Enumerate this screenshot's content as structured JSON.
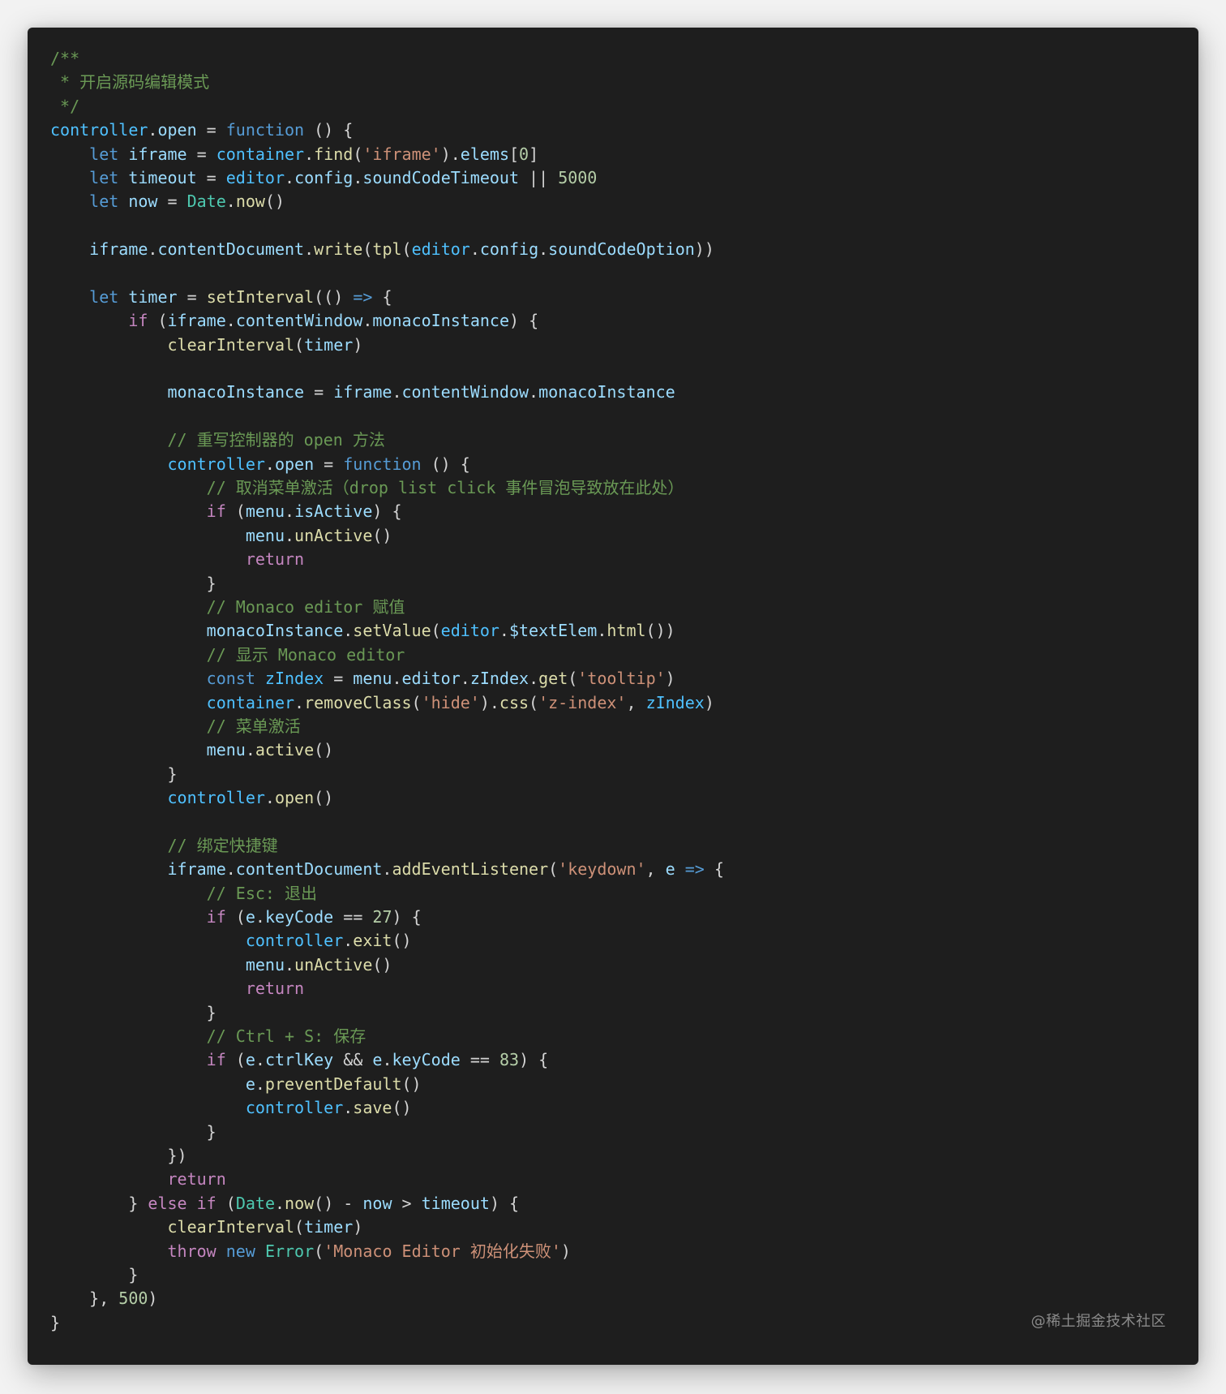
{
  "code": {
    "language": "javascript",
    "lines": [
      [
        {
          "t": "/**",
          "c": "comment"
        }
      ],
      [
        {
          "t": " * 开启源码编辑模式",
          "c": "comment"
        }
      ],
      [
        {
          "t": " */",
          "c": "comment"
        }
      ],
      [
        {
          "t": "controller",
          "c": "obj"
        },
        {
          "t": ".",
          "c": "plain"
        },
        {
          "t": "open",
          "c": "var"
        },
        {
          "t": " = ",
          "c": "plain"
        },
        {
          "t": "function",
          "c": "key"
        },
        {
          "t": " () {",
          "c": "plain"
        }
      ],
      [
        {
          "t": "    ",
          "c": "plain"
        },
        {
          "t": "let",
          "c": "key"
        },
        {
          "t": " ",
          "c": "plain"
        },
        {
          "t": "iframe",
          "c": "var"
        },
        {
          "t": " = ",
          "c": "plain"
        },
        {
          "t": "container",
          "c": "obj"
        },
        {
          "t": ".",
          "c": "plain"
        },
        {
          "t": "find",
          "c": "fn"
        },
        {
          "t": "(",
          "c": "plain"
        },
        {
          "t": "'iframe'",
          "c": "str"
        },
        {
          "t": ").",
          "c": "plain"
        },
        {
          "t": "elems",
          "c": "var"
        },
        {
          "t": "[",
          "c": "plain"
        },
        {
          "t": "0",
          "c": "num"
        },
        {
          "t": "]",
          "c": "plain"
        }
      ],
      [
        {
          "t": "    ",
          "c": "plain"
        },
        {
          "t": "let",
          "c": "key"
        },
        {
          "t": " ",
          "c": "plain"
        },
        {
          "t": "timeout",
          "c": "var"
        },
        {
          "t": " = ",
          "c": "plain"
        },
        {
          "t": "editor",
          "c": "obj"
        },
        {
          "t": ".",
          "c": "plain"
        },
        {
          "t": "config",
          "c": "var"
        },
        {
          "t": ".",
          "c": "plain"
        },
        {
          "t": "soundCodeTimeout",
          "c": "var"
        },
        {
          "t": " || ",
          "c": "plain"
        },
        {
          "t": "5000",
          "c": "num"
        }
      ],
      [
        {
          "t": "    ",
          "c": "plain"
        },
        {
          "t": "let",
          "c": "key"
        },
        {
          "t": " ",
          "c": "plain"
        },
        {
          "t": "now",
          "c": "var"
        },
        {
          "t": " = ",
          "c": "plain"
        },
        {
          "t": "Date",
          "c": "type"
        },
        {
          "t": ".",
          "c": "plain"
        },
        {
          "t": "now",
          "c": "fn"
        },
        {
          "t": "()",
          "c": "plain"
        }
      ],
      [],
      [
        {
          "t": "    ",
          "c": "plain"
        },
        {
          "t": "iframe",
          "c": "var"
        },
        {
          "t": ".",
          "c": "plain"
        },
        {
          "t": "contentDocument",
          "c": "var"
        },
        {
          "t": ".",
          "c": "plain"
        },
        {
          "t": "write",
          "c": "fn"
        },
        {
          "t": "(",
          "c": "plain"
        },
        {
          "t": "tpl",
          "c": "fn"
        },
        {
          "t": "(",
          "c": "plain"
        },
        {
          "t": "editor",
          "c": "obj"
        },
        {
          "t": ".",
          "c": "plain"
        },
        {
          "t": "config",
          "c": "var"
        },
        {
          "t": ".",
          "c": "plain"
        },
        {
          "t": "soundCodeOption",
          "c": "var"
        },
        {
          "t": "))",
          "c": "plain"
        }
      ],
      [],
      [
        {
          "t": "    ",
          "c": "plain"
        },
        {
          "t": "let",
          "c": "key"
        },
        {
          "t": " ",
          "c": "plain"
        },
        {
          "t": "timer",
          "c": "var"
        },
        {
          "t": " = ",
          "c": "plain"
        },
        {
          "t": "setInterval",
          "c": "fn"
        },
        {
          "t": "(() ",
          "c": "plain"
        },
        {
          "t": "=>",
          "c": "key"
        },
        {
          "t": " {",
          "c": "plain"
        }
      ],
      [
        {
          "t": "        ",
          "c": "plain"
        },
        {
          "t": "if",
          "c": "ctrl"
        },
        {
          "t": " (",
          "c": "plain"
        },
        {
          "t": "iframe",
          "c": "var"
        },
        {
          "t": ".",
          "c": "plain"
        },
        {
          "t": "contentWindow",
          "c": "var"
        },
        {
          "t": ".",
          "c": "plain"
        },
        {
          "t": "monacoInstance",
          "c": "var"
        },
        {
          "t": ") {",
          "c": "plain"
        }
      ],
      [
        {
          "t": "            ",
          "c": "plain"
        },
        {
          "t": "clearInterval",
          "c": "fn"
        },
        {
          "t": "(",
          "c": "plain"
        },
        {
          "t": "timer",
          "c": "var"
        },
        {
          "t": ")",
          "c": "plain"
        }
      ],
      [],
      [
        {
          "t": "            ",
          "c": "plain"
        },
        {
          "t": "monacoInstance",
          "c": "var"
        },
        {
          "t": " = ",
          "c": "plain"
        },
        {
          "t": "iframe",
          "c": "var"
        },
        {
          "t": ".",
          "c": "plain"
        },
        {
          "t": "contentWindow",
          "c": "var"
        },
        {
          "t": ".",
          "c": "plain"
        },
        {
          "t": "monacoInstance",
          "c": "var"
        }
      ],
      [],
      [
        {
          "t": "            ",
          "c": "plain"
        },
        {
          "t": "// 重写控制器的 open 方法",
          "c": "comment"
        }
      ],
      [
        {
          "t": "            ",
          "c": "plain"
        },
        {
          "t": "controller",
          "c": "obj"
        },
        {
          "t": ".",
          "c": "plain"
        },
        {
          "t": "open",
          "c": "var"
        },
        {
          "t": " = ",
          "c": "plain"
        },
        {
          "t": "function",
          "c": "key"
        },
        {
          "t": " () {",
          "c": "plain"
        }
      ],
      [
        {
          "t": "                ",
          "c": "plain"
        },
        {
          "t": "// 取消菜单激活（drop list click 事件冒泡导致放在此处）",
          "c": "comment"
        }
      ],
      [
        {
          "t": "                ",
          "c": "plain"
        },
        {
          "t": "if",
          "c": "ctrl"
        },
        {
          "t": " (",
          "c": "plain"
        },
        {
          "t": "menu",
          "c": "var"
        },
        {
          "t": ".",
          "c": "plain"
        },
        {
          "t": "isActive",
          "c": "var"
        },
        {
          "t": ") {",
          "c": "plain"
        }
      ],
      [
        {
          "t": "                    ",
          "c": "plain"
        },
        {
          "t": "menu",
          "c": "var"
        },
        {
          "t": ".",
          "c": "plain"
        },
        {
          "t": "unActive",
          "c": "fn"
        },
        {
          "t": "()",
          "c": "plain"
        }
      ],
      [
        {
          "t": "                    ",
          "c": "plain"
        },
        {
          "t": "return",
          "c": "ctrl"
        }
      ],
      [
        {
          "t": "                }",
          "c": "plain"
        }
      ],
      [
        {
          "t": "                ",
          "c": "plain"
        },
        {
          "t": "// Monaco editor 赋值",
          "c": "comment"
        }
      ],
      [
        {
          "t": "                ",
          "c": "plain"
        },
        {
          "t": "monacoInstance",
          "c": "var"
        },
        {
          "t": ".",
          "c": "plain"
        },
        {
          "t": "setValue",
          "c": "fn"
        },
        {
          "t": "(",
          "c": "plain"
        },
        {
          "t": "editor",
          "c": "obj"
        },
        {
          "t": ".",
          "c": "plain"
        },
        {
          "t": "$textElem",
          "c": "var"
        },
        {
          "t": ".",
          "c": "plain"
        },
        {
          "t": "html",
          "c": "fn"
        },
        {
          "t": "())",
          "c": "plain"
        }
      ],
      [
        {
          "t": "                ",
          "c": "plain"
        },
        {
          "t": "// 显示 Monaco editor",
          "c": "comment"
        }
      ],
      [
        {
          "t": "                ",
          "c": "plain"
        },
        {
          "t": "const",
          "c": "key"
        },
        {
          "t": " ",
          "c": "plain"
        },
        {
          "t": "zIndex",
          "c": "obj"
        },
        {
          "t": " = ",
          "c": "plain"
        },
        {
          "t": "menu",
          "c": "var"
        },
        {
          "t": ".",
          "c": "plain"
        },
        {
          "t": "editor",
          "c": "var"
        },
        {
          "t": ".",
          "c": "plain"
        },
        {
          "t": "zIndex",
          "c": "var"
        },
        {
          "t": ".",
          "c": "plain"
        },
        {
          "t": "get",
          "c": "fn"
        },
        {
          "t": "(",
          "c": "plain"
        },
        {
          "t": "'tooltip'",
          "c": "str"
        },
        {
          "t": ")",
          "c": "plain"
        }
      ],
      [
        {
          "t": "                ",
          "c": "plain"
        },
        {
          "t": "container",
          "c": "obj"
        },
        {
          "t": ".",
          "c": "plain"
        },
        {
          "t": "removeClass",
          "c": "fn"
        },
        {
          "t": "(",
          "c": "plain"
        },
        {
          "t": "'hide'",
          "c": "str"
        },
        {
          "t": ").",
          "c": "plain"
        },
        {
          "t": "css",
          "c": "fn"
        },
        {
          "t": "(",
          "c": "plain"
        },
        {
          "t": "'z-index'",
          "c": "str"
        },
        {
          "t": ", ",
          "c": "plain"
        },
        {
          "t": "zIndex",
          "c": "obj"
        },
        {
          "t": ")",
          "c": "plain"
        }
      ],
      [
        {
          "t": "                ",
          "c": "plain"
        },
        {
          "t": "// 菜单激活",
          "c": "comment"
        }
      ],
      [
        {
          "t": "                ",
          "c": "plain"
        },
        {
          "t": "menu",
          "c": "var"
        },
        {
          "t": ".",
          "c": "plain"
        },
        {
          "t": "active",
          "c": "fn"
        },
        {
          "t": "()",
          "c": "plain"
        }
      ],
      [
        {
          "t": "            }",
          "c": "plain"
        }
      ],
      [
        {
          "t": "            ",
          "c": "plain"
        },
        {
          "t": "controller",
          "c": "obj"
        },
        {
          "t": ".",
          "c": "plain"
        },
        {
          "t": "open",
          "c": "fn"
        },
        {
          "t": "()",
          "c": "plain"
        }
      ],
      [],
      [
        {
          "t": "            ",
          "c": "plain"
        },
        {
          "t": "// 绑定快捷键",
          "c": "comment"
        }
      ],
      [
        {
          "t": "            ",
          "c": "plain"
        },
        {
          "t": "iframe",
          "c": "var"
        },
        {
          "t": ".",
          "c": "plain"
        },
        {
          "t": "contentDocument",
          "c": "var"
        },
        {
          "t": ".",
          "c": "plain"
        },
        {
          "t": "addEventListener",
          "c": "fn"
        },
        {
          "t": "(",
          "c": "plain"
        },
        {
          "t": "'keydown'",
          "c": "str"
        },
        {
          "t": ", ",
          "c": "plain"
        },
        {
          "t": "e",
          "c": "var"
        },
        {
          "t": " ",
          "c": "plain"
        },
        {
          "t": "=>",
          "c": "key"
        },
        {
          "t": " {",
          "c": "plain"
        }
      ],
      [
        {
          "t": "                ",
          "c": "plain"
        },
        {
          "t": "// Esc: 退出",
          "c": "comment"
        }
      ],
      [
        {
          "t": "                ",
          "c": "plain"
        },
        {
          "t": "if",
          "c": "ctrl"
        },
        {
          "t": " (",
          "c": "plain"
        },
        {
          "t": "e",
          "c": "var"
        },
        {
          "t": ".",
          "c": "plain"
        },
        {
          "t": "keyCode",
          "c": "var"
        },
        {
          "t": " == ",
          "c": "plain"
        },
        {
          "t": "27",
          "c": "num"
        },
        {
          "t": ") {",
          "c": "plain"
        }
      ],
      [
        {
          "t": "                    ",
          "c": "plain"
        },
        {
          "t": "controller",
          "c": "obj"
        },
        {
          "t": ".",
          "c": "plain"
        },
        {
          "t": "exit",
          "c": "fn"
        },
        {
          "t": "()",
          "c": "plain"
        }
      ],
      [
        {
          "t": "                    ",
          "c": "plain"
        },
        {
          "t": "menu",
          "c": "var"
        },
        {
          "t": ".",
          "c": "plain"
        },
        {
          "t": "unActive",
          "c": "fn"
        },
        {
          "t": "()",
          "c": "plain"
        }
      ],
      [
        {
          "t": "                    ",
          "c": "plain"
        },
        {
          "t": "return",
          "c": "ctrl"
        }
      ],
      [
        {
          "t": "                }",
          "c": "plain"
        }
      ],
      [
        {
          "t": "                ",
          "c": "plain"
        },
        {
          "t": "// Ctrl + S: 保存",
          "c": "comment"
        }
      ],
      [
        {
          "t": "                ",
          "c": "plain"
        },
        {
          "t": "if",
          "c": "ctrl"
        },
        {
          "t": " (",
          "c": "plain"
        },
        {
          "t": "e",
          "c": "var"
        },
        {
          "t": ".",
          "c": "plain"
        },
        {
          "t": "ctrlKey",
          "c": "var"
        },
        {
          "t": " && ",
          "c": "plain"
        },
        {
          "t": "e",
          "c": "var"
        },
        {
          "t": ".",
          "c": "plain"
        },
        {
          "t": "keyCode",
          "c": "var"
        },
        {
          "t": " == ",
          "c": "plain"
        },
        {
          "t": "83",
          "c": "num"
        },
        {
          "t": ") {",
          "c": "plain"
        }
      ],
      [
        {
          "t": "                    ",
          "c": "plain"
        },
        {
          "t": "e",
          "c": "var"
        },
        {
          "t": ".",
          "c": "plain"
        },
        {
          "t": "preventDefault",
          "c": "fn"
        },
        {
          "t": "()",
          "c": "plain"
        }
      ],
      [
        {
          "t": "                    ",
          "c": "plain"
        },
        {
          "t": "controller",
          "c": "obj"
        },
        {
          "t": ".",
          "c": "plain"
        },
        {
          "t": "save",
          "c": "fn"
        },
        {
          "t": "()",
          "c": "plain"
        }
      ],
      [
        {
          "t": "                }",
          "c": "plain"
        }
      ],
      [
        {
          "t": "            })",
          "c": "plain"
        }
      ],
      [
        {
          "t": "            ",
          "c": "plain"
        },
        {
          "t": "return",
          "c": "ctrl"
        }
      ],
      [
        {
          "t": "        } ",
          "c": "plain"
        },
        {
          "t": "else",
          "c": "ctrl"
        },
        {
          "t": " ",
          "c": "plain"
        },
        {
          "t": "if",
          "c": "ctrl"
        },
        {
          "t": " (",
          "c": "plain"
        },
        {
          "t": "Date",
          "c": "type"
        },
        {
          "t": ".",
          "c": "plain"
        },
        {
          "t": "now",
          "c": "fn"
        },
        {
          "t": "() - ",
          "c": "plain"
        },
        {
          "t": "now",
          "c": "var"
        },
        {
          "t": " > ",
          "c": "plain"
        },
        {
          "t": "timeout",
          "c": "var"
        },
        {
          "t": ") {",
          "c": "plain"
        }
      ],
      [
        {
          "t": "            ",
          "c": "plain"
        },
        {
          "t": "clearInterval",
          "c": "fn"
        },
        {
          "t": "(",
          "c": "plain"
        },
        {
          "t": "timer",
          "c": "var"
        },
        {
          "t": ")",
          "c": "plain"
        }
      ],
      [
        {
          "t": "            ",
          "c": "plain"
        },
        {
          "t": "throw",
          "c": "ctrl"
        },
        {
          "t": " ",
          "c": "plain"
        },
        {
          "t": "new",
          "c": "key"
        },
        {
          "t": " ",
          "c": "plain"
        },
        {
          "t": "Error",
          "c": "type"
        },
        {
          "t": "(",
          "c": "plain"
        },
        {
          "t": "'Monaco Editor 初始化失败'",
          "c": "str"
        },
        {
          "t": ")",
          "c": "plain"
        }
      ],
      [
        {
          "t": "        }",
          "c": "plain"
        }
      ],
      [
        {
          "t": "    }, ",
          "c": "plain"
        },
        {
          "t": "500",
          "c": "num"
        },
        {
          "t": ")",
          "c": "plain"
        }
      ],
      [
        {
          "t": "}",
          "c": "plain"
        }
      ]
    ]
  },
  "colors": {
    "background": "#1e1e1e",
    "page": "#f2f2f2",
    "comment": "#6a9955",
    "keyword": "#569cd6",
    "control": "#c586c0",
    "function": "#dcdcaa",
    "variable": "#9cdcfe",
    "string": "#ce9178",
    "number": "#b5cea8",
    "type": "#4ec9b0",
    "object": "#4fc1ff",
    "plain": "#d4d4d4"
  },
  "watermark": "@稀土掘金技术社区"
}
